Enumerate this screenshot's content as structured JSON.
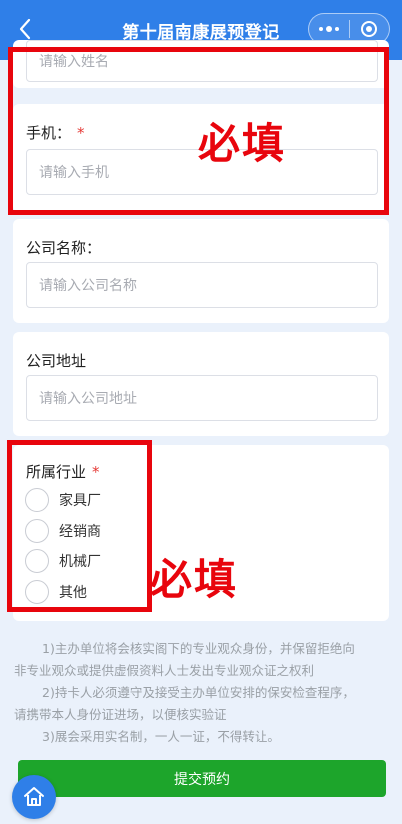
{
  "nav": {
    "title": "第十届南康展预登记",
    "back_icon": "chevron-left-icon",
    "more_icon": "more-dots-icon",
    "close_icon": "target-circle-icon"
  },
  "fields": {
    "name": {
      "placeholder": "请输入姓名"
    },
    "phone": {
      "label": "手机：",
      "required_mark": "*",
      "placeholder": "请输入手机"
    },
    "company_name": {
      "label": "公司名称：",
      "placeholder": "请输入公司名称"
    },
    "company_address": {
      "label": "公司地址",
      "placeholder": "请输入公司地址"
    },
    "industry": {
      "label": "所属行业",
      "required_mark": "*",
      "options": [
        "家具厂",
        "经销商",
        "机械厂",
        "其他"
      ]
    }
  },
  "annotations": {
    "must_fill_1": "必填",
    "must_fill_2": "必填",
    "accent_color": "#e8050d"
  },
  "notes": [
    "1)主办单位将会核实阁下的专业观众身份，并保留拒绝向",
    "非专业观众或提供虚假资料人士发出专业观众证之权利",
    "2)持卡人必须遵守及接受主办单位安排的保安检查程序，",
    "请携带本人身份证进场，以便核实验证",
    "3)展会采用实名制，一人一证，不得转让。"
  ],
  "submit": {
    "label": "提交预约",
    "color": "#1da52b"
  },
  "home_icon": "home-icon",
  "colors": {
    "nav": "#2f7fe8",
    "background": "#eaf1fb"
  }
}
